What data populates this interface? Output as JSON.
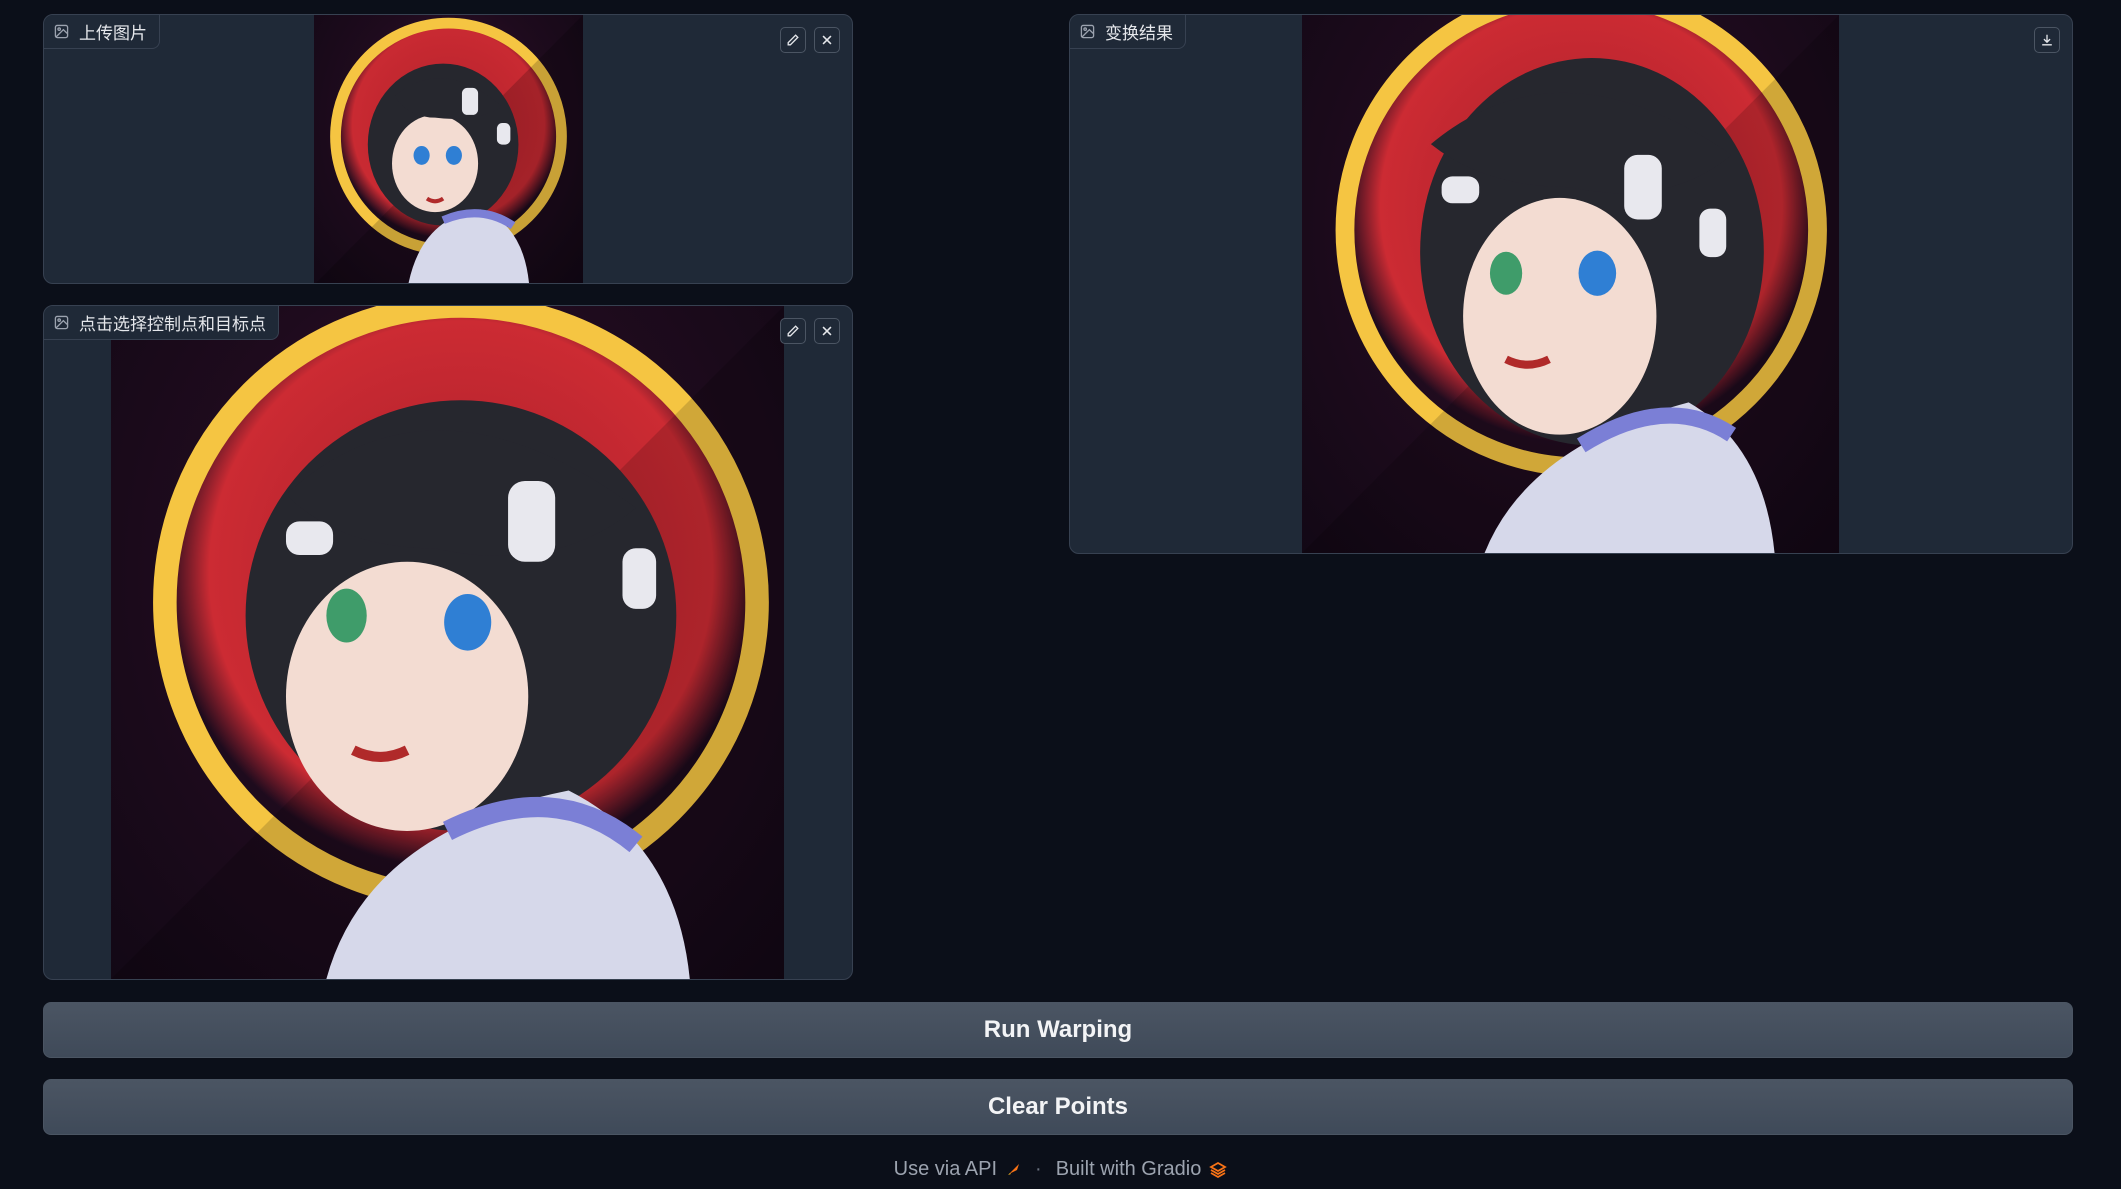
{
  "upload_panel": {
    "label": "上传图片",
    "icons": [
      "image-icon",
      "edit-icon",
      "close-icon"
    ]
  },
  "points_panel": {
    "label": "点击选择控制点和目标点",
    "icons": [
      "image-icon",
      "edit-icon",
      "close-icon"
    ]
  },
  "result_panel": {
    "label": "变换结果",
    "icons": [
      "image-icon",
      "download-icon"
    ]
  },
  "buttons": {
    "run": "Run Warping",
    "clear": "Clear Points"
  },
  "footer": {
    "api": "Use via API",
    "separator": "·",
    "built": "Built with Gradio",
    "icons": [
      "rocket-icon",
      "gradio-logo-icon"
    ]
  },
  "colors": {
    "background": "#0b0f19",
    "panel": "#1f2937",
    "border": "#374151",
    "button": "#4b5563",
    "gradio_orange": "#f97316"
  }
}
